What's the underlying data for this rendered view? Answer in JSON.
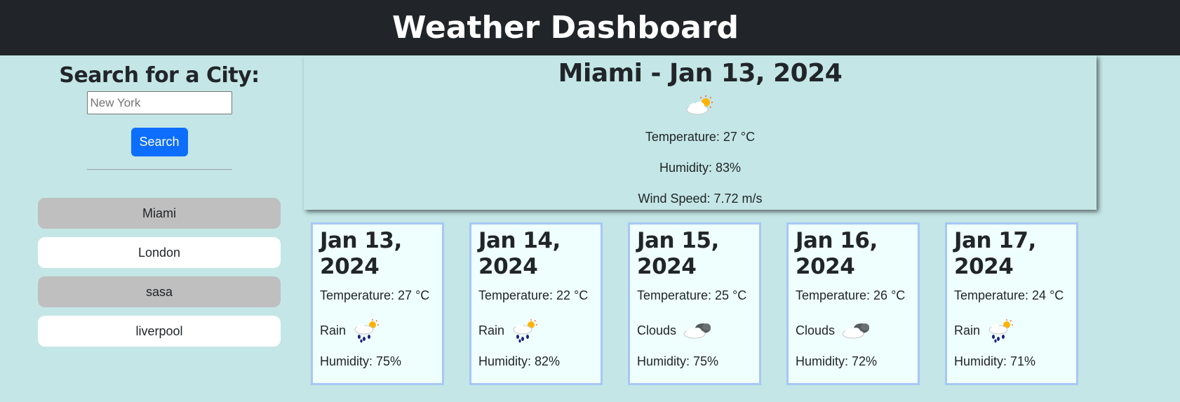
{
  "header": {
    "title": "Weather Dashboard"
  },
  "search": {
    "title": "Search for a City:",
    "placeholder": "New York",
    "button_label": "Search"
  },
  "history": [
    {
      "label": "Miami",
      "style": "gray"
    },
    {
      "label": "London",
      "style": "white"
    },
    {
      "label": "sasa",
      "style": "gray"
    },
    {
      "label": "liverpool",
      "style": "white"
    }
  ],
  "current": {
    "title": "Miami - Jan 13, 2024",
    "icon": "partly-cloudy-sun-icon",
    "temperature": "Temperature: 27 °C",
    "humidity": "Humidity: 83%",
    "wind": "Wind Speed: 7.72 m/s"
  },
  "forecast": [
    {
      "date": "Jan 13, 2024",
      "date_l1": "Jan 13,",
      "date_l2": "2024",
      "temperature": "Temperature: 27 °C",
      "condition": "Rain",
      "icon": "rain-sun-icon",
      "humidity": "Humidity: 75%"
    },
    {
      "date": "Jan 14, 2024",
      "date_l1": "Jan 14,",
      "date_l2": "2024",
      "temperature": "Temperature: 22 °C",
      "condition": "Rain",
      "icon": "rain-sun-icon",
      "humidity": "Humidity: 82%"
    },
    {
      "date": "Jan 15, 2024",
      "date_l1": "Jan 15,",
      "date_l2": "2024",
      "temperature": "Temperature: 25 °C",
      "condition": "Clouds",
      "icon": "dark-clouds-icon",
      "humidity": "Humidity: 75%"
    },
    {
      "date": "Jan 16, 2024",
      "date_l1": "Jan 16,",
      "date_l2": "2024",
      "temperature": "Temperature: 26 °C",
      "condition": "Clouds",
      "icon": "dark-clouds-icon",
      "humidity": "Humidity: 72%"
    },
    {
      "date": "Jan 17, 2024",
      "date_l1": "Jan 17,",
      "date_l2": "2024",
      "temperature": "Temperature: 24 °C",
      "condition": "Rain",
      "icon": "rain-sun-icon",
      "humidity": "Humidity: 71%"
    }
  ],
  "colors": {
    "background": "#c4e6e6",
    "header": "#212529",
    "button": "#0d6efd",
    "card_border": "#a7c7f5",
    "card_background": "#effffe",
    "history_gray": "#bfbfbf"
  }
}
